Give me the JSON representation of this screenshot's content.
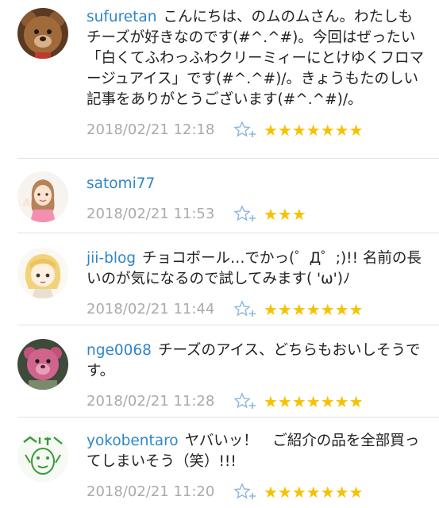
{
  "comments": [
    {
      "username": "sufuretan",
      "text": "こんにちは、のムのムさん。わたしもチーズが好きなのです(#^.^#)。今回はぜったい「白くてふわっふわクリーミィーにとけゆくフロマージュアイス」です(#^.^#)/。きょうもたのしい記事をありがとうございます(#^.^#)/。",
      "date": "2018/02/21 12:18",
      "stars": "★★★★★★★",
      "avatar": "teddy-bear"
    },
    {
      "username": "satomi77",
      "text": "",
      "date": "2018/02/21 11:53",
      "stars": "★★★",
      "avatar": "girl-illustration"
    },
    {
      "username": "jii-blog",
      "text": "チョコボール…でかっ(゜Д゜;)!! 名前の長いのが気になるので試してみます( 'ω')ﾉ",
      "date": "2018/02/21 11:44",
      "stars": "★★★★★★★",
      "avatar": "blonde-character"
    },
    {
      "username": "nge0068",
      "text": "チーズのアイス、どちらもおいしそうです。",
      "date": "2018/02/21 11:28",
      "stars": "★★★★★★★",
      "avatar": "pink-bear-toy"
    },
    {
      "username": "yokobentaro",
      "text": "ヤバいッ！　ご紹介の品を全部買ってしまいそう（笑）!!!",
      "date": "2018/02/21 11:20",
      "stars": "★★★★★★★",
      "avatar": "green-stamp"
    }
  ],
  "colors": {
    "username": "#2e86c8",
    "date": "#aaaaaa",
    "star": "#f5c200",
    "add_star": "#8ab6e0"
  },
  "icons": {
    "add_star": "add-star-icon"
  }
}
